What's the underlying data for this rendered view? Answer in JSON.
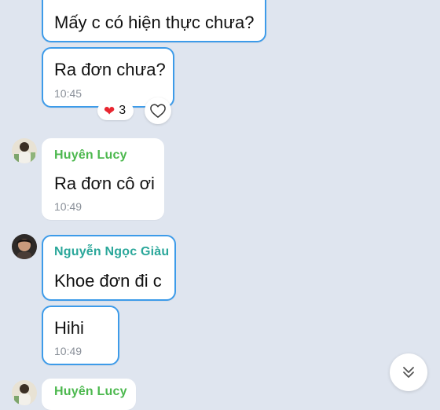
{
  "colors": {
    "background": "#dfe5ef",
    "selected_border": "#3d9be9",
    "sender_green": "#4cb84e",
    "sender_teal": "#2aa79a",
    "heart": "#e8252f"
  },
  "messages": [
    {
      "text": "Mấy c có hiện thực chưa?"
    },
    {
      "text": "Ra đơn chưa?",
      "time": "10:45",
      "reaction": {
        "icon": "heart-icon",
        "count": "3"
      }
    },
    {
      "sender": "Huyên Lucy",
      "text": "Ra đơn cô ơi",
      "time": "10:49"
    },
    {
      "sender": "Nguyễn Ngọc Giàu",
      "text": "Khoe đơn đi c"
    },
    {
      "text": "Hihi",
      "time": "10:49"
    },
    {
      "sender": "Huyên Lucy"
    }
  ],
  "icons": {
    "add_reaction": "heart-outline-icon",
    "scroll_down": "double-chevron-down-icon"
  }
}
